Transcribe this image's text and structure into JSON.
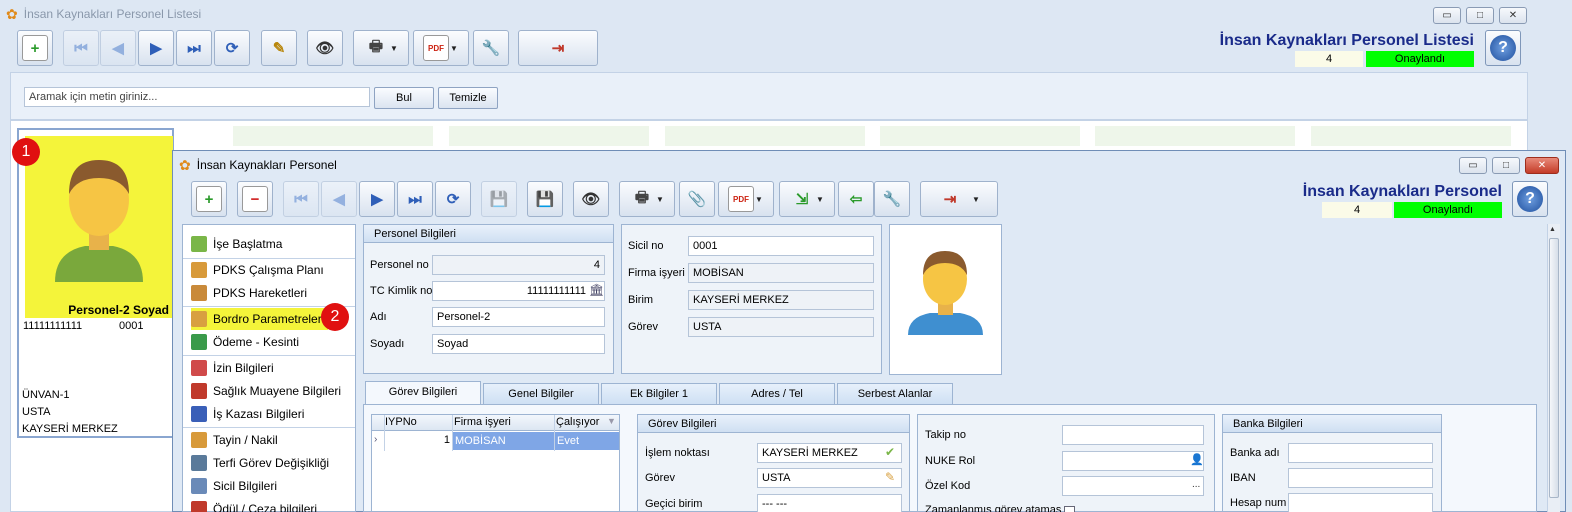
{
  "outer": {
    "title": "İnsan Kaynakları Personel Listesi",
    "header_title": "İnsan Kaynakları Personel Listesi",
    "count": "4",
    "status": "Onaylandı",
    "search_placeholder": "Aramak için metin giriniz...",
    "search_button": "Bul",
    "clear_button": "Temizle",
    "card": {
      "badge": "1",
      "name": "Personel-2 Soyad",
      "tc": "11111111111",
      "sicil": "0001",
      "unvan": "ÜNVAN-1",
      "gorev": "USTA",
      "birim": "KAYSERİ MERKEZ"
    },
    "window_buttons": {
      "min": "▭",
      "max": "□",
      "close": "✕"
    }
  },
  "inner": {
    "title": "İnsan Kaynakları Personel",
    "header_title": "İnsan Kaynakları Personel",
    "count": "4",
    "status": "Onaylandı",
    "window_buttons": {
      "min": "▭",
      "max": "□",
      "close": "✕"
    },
    "menu": [
      {
        "label": "İşe Başlatma"
      },
      {
        "label": "PDKS Çalışma Planı"
      },
      {
        "label": "PDKS Hareketleri"
      },
      {
        "label": "Bordro Parametreleri"
      },
      {
        "label": "Ödeme - Kesinti"
      },
      {
        "label": "İzin Bilgileri"
      },
      {
        "label": "Sağlık Muayene Bilgileri"
      },
      {
        "label": "İş Kazası Bilgileri"
      },
      {
        "label": "Tayin / Nakil"
      },
      {
        "label": "Terfi Görev Değişikliği"
      },
      {
        "label": "Sicil Bilgileri"
      },
      {
        "label": "Ödül / Ceza bilgileri"
      }
    ],
    "menu_badge": "2",
    "personel": {
      "group_title": "Personel Bilgileri",
      "no_label": "Personel no",
      "no_value": "4",
      "tc_label": "TC Kimlik no",
      "tc_value": "11111111111",
      "ad_label": "Adı",
      "ad_value": "Personel-2",
      "soyad_label": "Soyadı",
      "soyad_value": "Soyad"
    },
    "info": {
      "sicil_label": "Sicil no",
      "sicil_value": "0001",
      "firma_label": "Firma işyeri",
      "firma_value": "MOBİSAN",
      "birim_label": "Birim",
      "birim_value": "KAYSERİ MERKEZ",
      "gorev_label": "Görev",
      "gorev_value": "USTA"
    },
    "tabs": [
      "Görev Bilgileri",
      "Genel Bilgiler",
      "Ek Bilgiler 1",
      "Adres / Tel",
      "Serbest Alanlar"
    ],
    "grid": {
      "columns": [
        "IYPNo",
        "Firma işyeri",
        "Çalışıyor"
      ],
      "rows": [
        {
          "no": "1",
          "firma": "MOBİSAN",
          "calisiyor": "Evet"
        }
      ]
    },
    "gorev_bilgileri": {
      "title": "Görev Bilgileri",
      "islem_label": "İşlem noktası",
      "islem_value": "KAYSERİ MERKEZ",
      "gorev_label": "Görev",
      "gorev_value": "USTA",
      "gecici_label": "Geçici birim",
      "gecici_value": "--- ---"
    },
    "takip": {
      "takip_label": "Takip no",
      "nuke_label": "NUKE Rol",
      "ozel_label": "Özel Kod",
      "ozel_btn": "...",
      "zaman_label": "Zamanlanmış görev atamas"
    },
    "banka": {
      "title": "Banka Bilgileri",
      "banka_label": "Banka adı",
      "iban_label": "IBAN",
      "hesap_label": "Hesap num"
    }
  },
  "colors": {
    "status_ok": "#00ff00",
    "card_bg": "#f4f43a",
    "badge": "#e01010",
    "selected_row": "#7fa6e6"
  }
}
